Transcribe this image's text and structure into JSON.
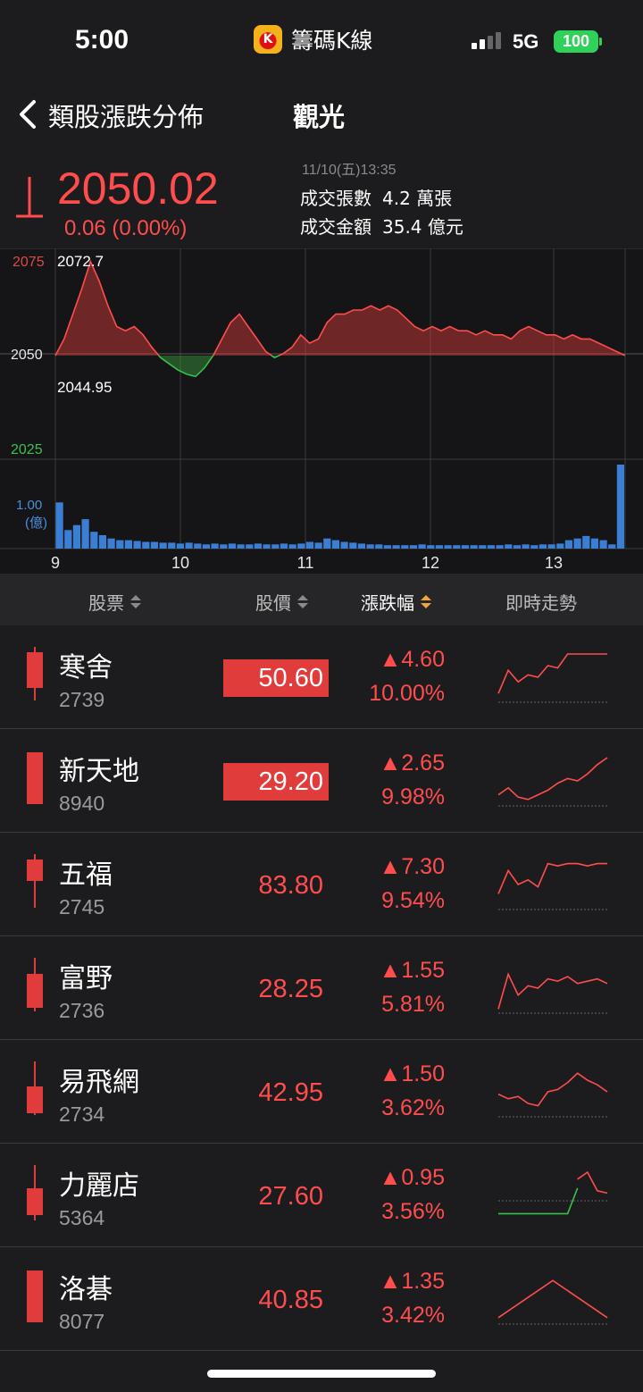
{
  "status_bar": {
    "time": "5:00",
    "app_name": "籌碼K線",
    "app_logo_letter": "K",
    "network": "5G",
    "battery": "100"
  },
  "nav": {
    "back_label": "類股漲跌分佈",
    "title": "觀光"
  },
  "index": {
    "value": "2050.02",
    "change": "0.06 (0.00%)",
    "timestamp": "11/10(五)13:35",
    "volume_label": "成交張數",
    "volume_value": "4.2 萬張",
    "amount_label": "成交金額",
    "amount_value": "35.4 億元"
  },
  "chart_data": {
    "type": "area",
    "y_ticks": [
      "2075",
      "2050",
      "2025"
    ],
    "high_label": "2072.7",
    "low_label": "2044.95",
    "reference": 2050,
    "ylim": [
      2025,
      2075
    ],
    "x_ticks": [
      "9",
      "10",
      "11",
      "12",
      "13"
    ],
    "volume_label": "1.00",
    "volume_unit": "(億)",
    "series": [
      {
        "values": [
          2050,
          2054,
          2060,
          2066,
          2072.7,
          2068,
          2062,
          2057,
          2056,
          2057,
          2055,
          2052,
          2049.5,
          2048,
          2046.5,
          2045.5,
          2044.95,
          2047,
          2050,
          2054,
          2058,
          2060,
          2057,
          2054,
          2051,
          2049.5,
          2050.5,
          2052,
          2055,
          2053,
          2054,
          2058,
          2060,
          2060,
          2061,
          2061,
          2062,
          2061,
          2062,
          2061,
          2059,
          2057,
          2056,
          2057,
          2056,
          2057,
          2056,
          2056,
          2055,
          2056,
          2055,
          2055,
          2054,
          2056,
          2057,
          2056,
          2055,
          2055,
          2054,
          2055,
          2054,
          2054,
          2053,
          2052,
          2051,
          2050.02
        ]
      }
    ],
    "volume": [
      0.55,
      0.22,
      0.28,
      0.35,
      0.2,
      0.16,
      0.12,
      0.1,
      0.1,
      0.09,
      0.08,
      0.08,
      0.07,
      0.07,
      0.06,
      0.07,
      0.06,
      0.05,
      0.06,
      0.05,
      0.06,
      0.05,
      0.05,
      0.06,
      0.05,
      0.05,
      0.06,
      0.05,
      0.06,
      0.08,
      0.07,
      0.12,
      0.1,
      0.08,
      0.07,
      0.06,
      0.05,
      0.05,
      0.04,
      0.04,
      0.04,
      0.04,
      0.05,
      0.04,
      0.04,
      0.04,
      0.04,
      0.04,
      0.04,
      0.04,
      0.04,
      0.04,
      0.05,
      0.04,
      0.05,
      0.04,
      0.05,
      0.05,
      0.06,
      0.1,
      0.12,
      0.15,
      0.12,
      0.1,
      0.05,
      1.0
    ]
  },
  "list_header": {
    "stock": "股票",
    "price": "股價",
    "change": "漲跌幅",
    "trend": "即時走勢"
  },
  "stocks": [
    {
      "name": "寒舍",
      "code": "2739",
      "price": "50.60",
      "change": "▲4.60",
      "pct": "10.00%",
      "limit_up": true,
      "spark": [
        0.15,
        0.65,
        0.4,
        0.55,
        0.5,
        0.75,
        0.7,
        1,
        1,
        1,
        1,
        1
      ],
      "spark_color": "#ff4d4d"
    },
    {
      "name": "新天地",
      "code": "8940",
      "price": "29.20",
      "change": "▲2.65",
      "pct": "9.98%",
      "limit_up": true,
      "spark": [
        0.2,
        0.35,
        0.15,
        0.1,
        0.2,
        0.3,
        0.45,
        0.55,
        0.5,
        0.65,
        0.85,
        1
      ],
      "spark_color": "#ff4d4d"
    },
    {
      "name": "五福",
      "code": "2745",
      "price": "83.80",
      "change": "▲7.30",
      "pct": "9.54%",
      "limit_up": false,
      "spark": [
        0.3,
        0.8,
        0.5,
        0.6,
        0.45,
        0.95,
        0.9,
        0.95,
        0.95,
        0.9,
        0.95,
        0.95
      ],
      "spark_color": "#ff4d4d"
    },
    {
      "name": "富野",
      "code": "2736",
      "price": "28.25",
      "change": "▲1.55",
      "pct": "5.81%",
      "limit_up": false,
      "spark": [
        0.05,
        0.8,
        0.35,
        0.55,
        0.5,
        0.7,
        0.65,
        0.75,
        0.6,
        0.65,
        0.7,
        0.6
      ],
      "spark_color": "#ff4d4d"
    },
    {
      "name": "易飛網",
      "code": "2734",
      "price": "42.95",
      "change": "▲1.50",
      "pct": "3.62%",
      "limit_up": false,
      "spark": [
        0.45,
        0.35,
        0.4,
        0.25,
        0.2,
        0.5,
        0.55,
        0.7,
        0.9,
        0.75,
        0.65,
        0.5
      ],
      "spark_color": "#ff4d4d"
    },
    {
      "name": "力麗店",
      "code": "5364",
      "price": "27.60",
      "change": "▲0.95",
      "pct": "3.56%",
      "limit_up": false,
      "spark": [
        0.3,
        0.3,
        0.3,
        0.3,
        0.3,
        0.3,
        0.3,
        0.3,
        0.85,
        1,
        0.6,
        0.55
      ],
      "spark_color": "#ff4d4d"
    },
    {
      "name": "洛碁",
      "code": "8077",
      "price": "40.85",
      "change": "▲1.35",
      "pct": "3.42%",
      "limit_up": false,
      "spark": [
        0.1,
        0.9,
        0.1
      ],
      "spark_color": "#ff4d4d"
    }
  ]
}
